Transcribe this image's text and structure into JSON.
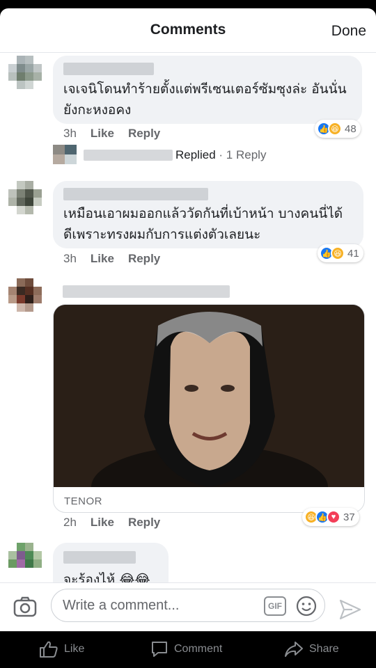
{
  "header": {
    "title": "Comments",
    "done_label": "Done"
  },
  "comments": [
    {
      "text_line1": "เจเจนิโดนทำร้ายตั้งแต่พรีเซนเตอร์ซัมซุงล่ะ อันนั่น",
      "text_line2": "ยังกะหงอคง",
      "time": "3h",
      "like_label": "Like",
      "reply_label": "Reply",
      "reaction_count": "48",
      "replied_label": "Replied",
      "replies_link": "1 Reply"
    },
    {
      "text_line1": "เหมือนเอาผมออกแล้ววัดกันที่เบ้าหน้า บางคนนี่ได้",
      "text_line2": "ดีเพราะทรงผมกับการแต่งตัวเลยนะ",
      "time": "3h",
      "like_label": "Like",
      "reply_label": "Reply",
      "reaction_count": "41"
    },
    {
      "gif_source": "TENOR",
      "time": "2h",
      "like_label": "Like",
      "reply_label": "Reply",
      "reaction_count": "37"
    },
    {
      "text_line1": "จะร้องไห้ 😂😂"
    }
  ],
  "composer": {
    "placeholder": "Write a comment...",
    "gif_label": "GIF"
  },
  "bottom_bar": {
    "like_label": "Like",
    "comment_label": "Comment",
    "share_label": "Share"
  },
  "colors": {
    "accent": "#1877f2",
    "bubble": "#f0f2f5",
    "meta": "#65676b"
  },
  "icons": [
    "camera-icon",
    "gif-icon",
    "smiley-icon",
    "send-icon",
    "thumbs-up-icon",
    "comment-icon",
    "share-icon"
  ]
}
